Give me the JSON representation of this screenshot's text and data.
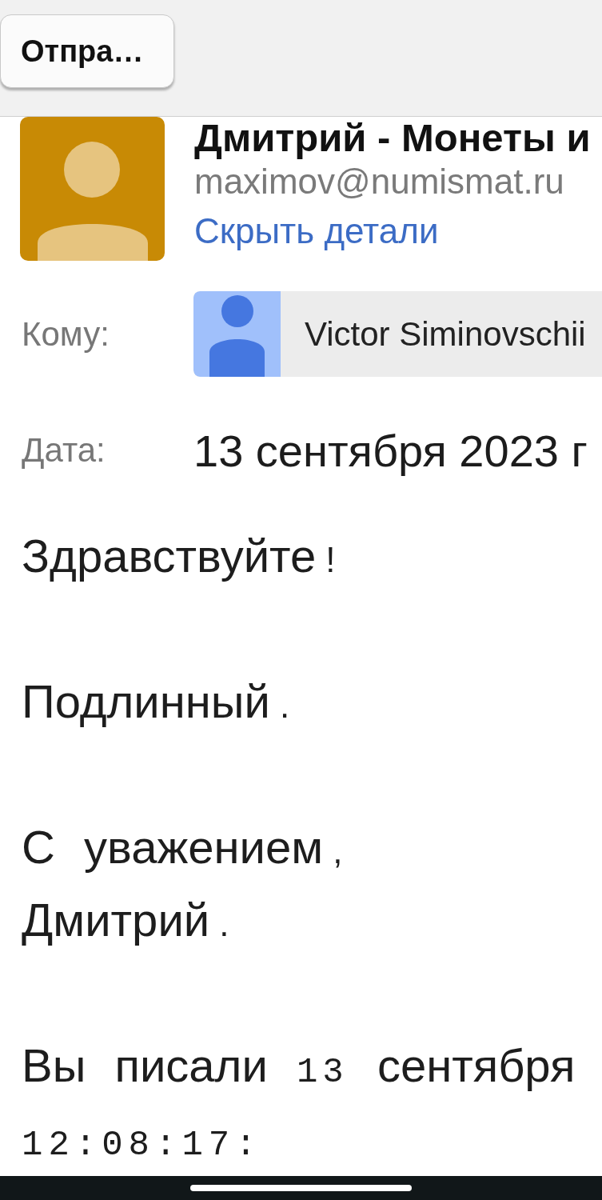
{
  "top_bar": {
    "back_button": {
      "label": "Отпра…"
    }
  },
  "sender": {
    "name": "Дмитрий - Монеты и",
    "email": "maximov@numismat.ru",
    "details_link": "Скрыть детали"
  },
  "recipients": {
    "label": "Кому:",
    "items": [
      {
        "name": "Victor Siminovschii"
      }
    ]
  },
  "date": {
    "label": "Дата:",
    "value": "13 сентября 2023 г"
  },
  "message": {
    "paragraphs": [
      {
        "lines": [
          [
            {
              "kind": "word",
              "text": "Здравствуйте"
            },
            {
              "kind": "punct",
              "text": "!"
            }
          ]
        ]
      },
      {
        "lines": [
          [
            {
              "kind": "word",
              "text": "Подлинный"
            },
            {
              "kind": "punct",
              "text": "."
            }
          ]
        ]
      },
      {
        "lines": [
          [
            {
              "kind": "word",
              "text": "С"
            },
            {
              "kind": "word",
              "text": "уважением"
            },
            {
              "kind": "punct",
              "text": ","
            }
          ],
          [
            {
              "kind": "word",
              "text": "Дмитрий"
            },
            {
              "kind": "punct",
              "text": "."
            }
          ]
        ]
      },
      {
        "lines": [
          [
            {
              "kind": "word",
              "text": "Вы"
            },
            {
              "kind": "word",
              "text": "писали"
            },
            {
              "kind": "mono",
              "text": "13"
            },
            {
              "kind": "word",
              "text": "сентября"
            }
          ],
          [
            {
              "kind": "clock",
              "text": "12:08:17:"
            }
          ]
        ]
      }
    ]
  }
}
